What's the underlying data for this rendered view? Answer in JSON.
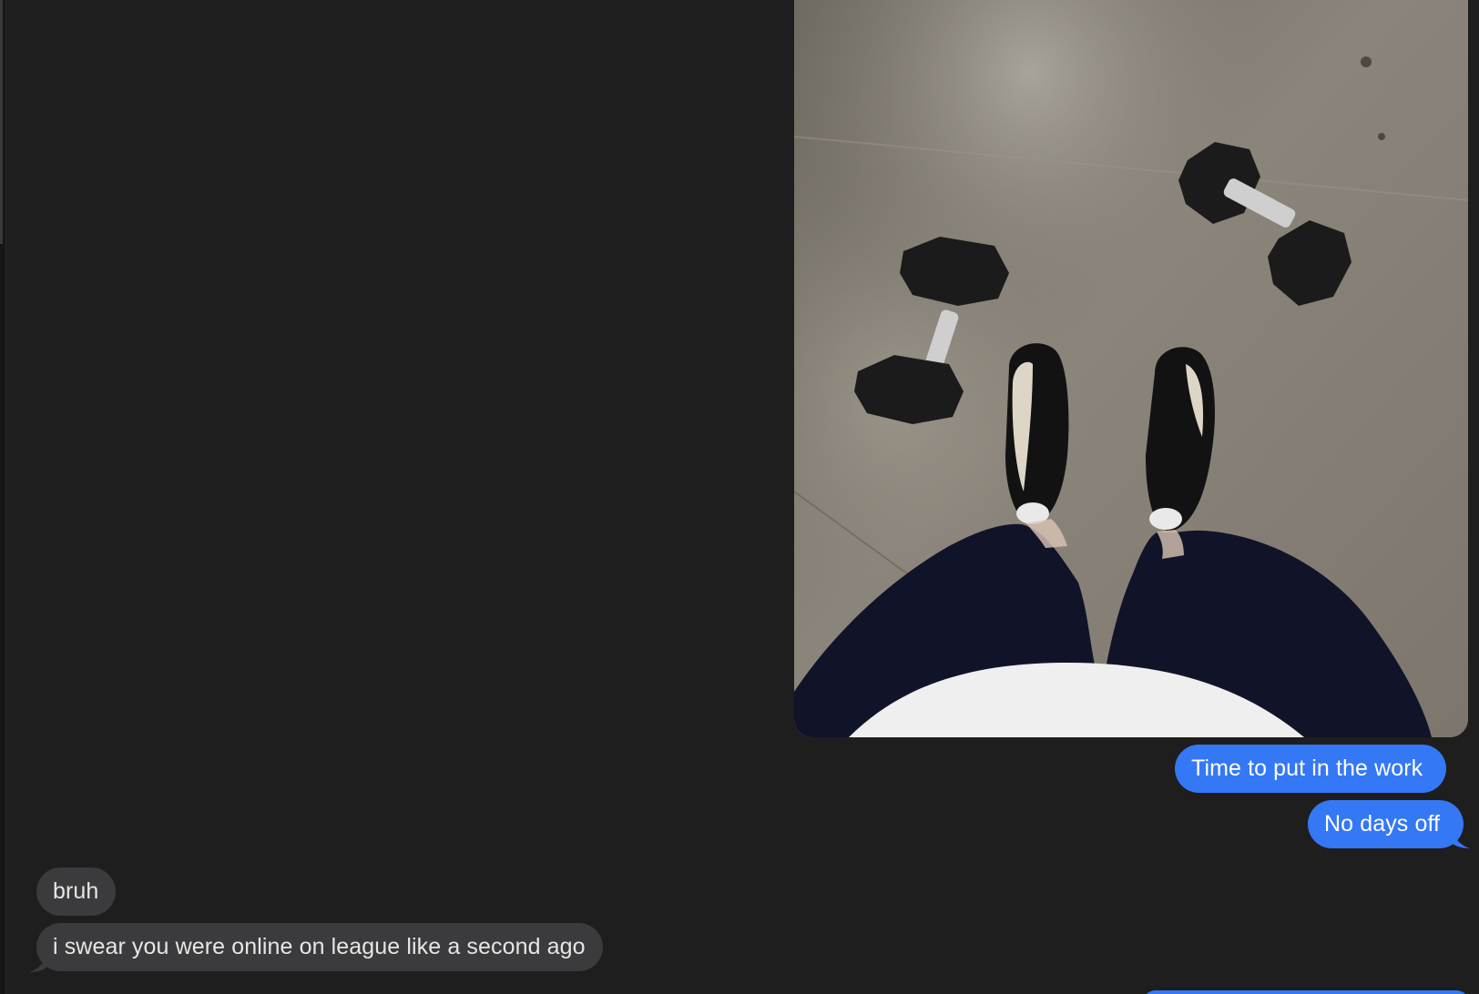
{
  "conversation": {
    "attachment": {
      "kind": "photo",
      "alt": "gym-floor-photo"
    },
    "messages": [
      {
        "direction": "sent",
        "text": "Time to put in the work"
      },
      {
        "direction": "sent",
        "text": "No days off"
      },
      {
        "direction": "received",
        "text": "bruh"
      },
      {
        "direction": "received",
        "text": "i swear you were online on league like a second ago"
      }
    ]
  },
  "colors": {
    "background": "#1e1e1e",
    "sent_bubble": "#3478f6",
    "received_bubble": "#3b3b3d",
    "sent_text": "#ffffff",
    "received_text": "#e6e6e6"
  }
}
